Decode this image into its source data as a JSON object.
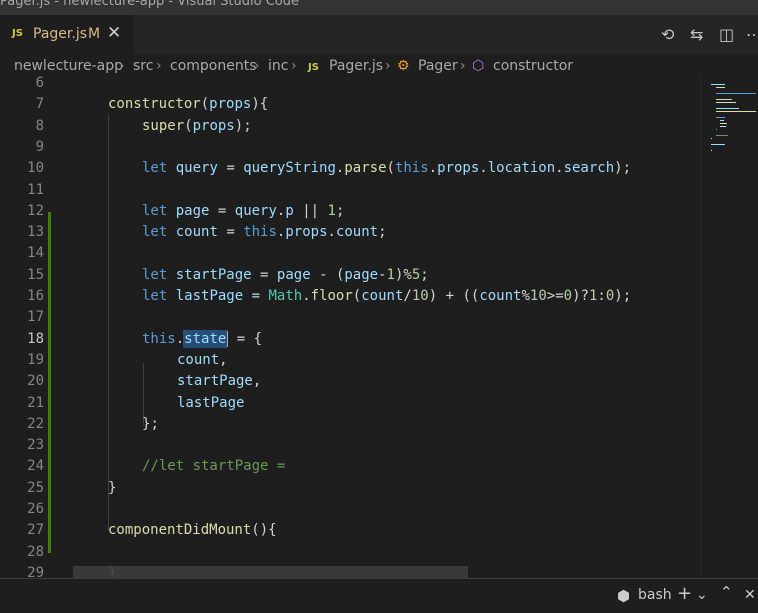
{
  "window": {
    "title": "Pager.js - newlecture-app - Visual Studio Code"
  },
  "tab": {
    "lang_badge": "JS",
    "filename": "Pager.js",
    "status": "M",
    "close": "✕"
  },
  "tab_actions": {
    "timeline": "⟲",
    "compare": "⇆",
    "split": "◫",
    "more": "⋯"
  },
  "breadcrumb": {
    "items": [
      "newlecture-app",
      "src",
      "components",
      "inc"
    ],
    "file_badge": "JS",
    "file": "Pager.js",
    "class": "Pager",
    "method": "constructor",
    "sep": "›"
  },
  "editor": {
    "active_line": "18",
    "selection": "state",
    "lines": [
      {
        "n": "6",
        "t": ""
      },
      {
        "n": "7",
        "t": "constructor(props){"
      },
      {
        "n": "8",
        "t": "super(props);"
      },
      {
        "n": "9",
        "t": ""
      },
      {
        "n": "10",
        "t": "let query = queryString.parse(this.props.location.search);"
      },
      {
        "n": "11",
        "t": ""
      },
      {
        "n": "12",
        "t": "let page = query.p || 1;"
      },
      {
        "n": "13",
        "t": "let count = this.props.count;"
      },
      {
        "n": "14",
        "t": ""
      },
      {
        "n": "15",
        "t": "let startPage = page - (page-1)%5;"
      },
      {
        "n": "16",
        "t": "let lastPage = Math.floor(count/10) + ((count%10>=0)?1:0);"
      },
      {
        "n": "17",
        "t": ""
      },
      {
        "n": "18",
        "t": "this.state = {"
      },
      {
        "n": "19",
        "t": "count,"
      },
      {
        "n": "20",
        "t": "startPage,"
      },
      {
        "n": "21",
        "t": "lastPage"
      },
      {
        "n": "22",
        "t": "};"
      },
      {
        "n": "23",
        "t": ""
      },
      {
        "n": "24",
        "t": "//let startPage ="
      },
      {
        "n": "25",
        "t": "}"
      },
      {
        "n": "26",
        "t": ""
      },
      {
        "n": "27",
        "t": "componentDidMount(){"
      },
      {
        "n": "28",
        "t": ""
      },
      {
        "n": "29",
        "t": "}"
      }
    ]
  },
  "panel": {
    "terminal_icon": "⬢",
    "shell": "bash",
    "add": "+",
    "dropdown": "⌄",
    "trash": "🗑",
    "maximize": "⌃",
    "close": "✕"
  },
  "colors": {
    "keyword": "#569cd6",
    "function": "#dcdcaa",
    "variable": "#9cdcfe",
    "number": "#b5cea8",
    "comment": "#6a9955",
    "modified": "#d7ba7d"
  }
}
